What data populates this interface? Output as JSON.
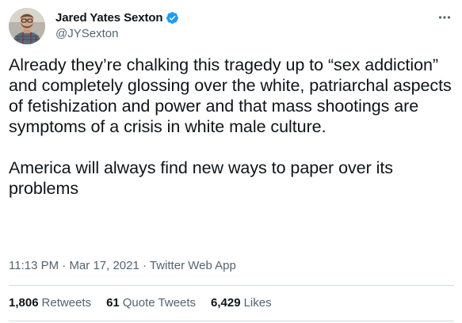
{
  "author": {
    "display_name": "Jared Yates Sexton",
    "handle": "@JYSexton",
    "verified": true,
    "avatar_icon": "user-avatar"
  },
  "tweet": {
    "text": "Already they’re chalking this tragedy up to “sex addiction” and completely glossing over the white, patriarchal aspects of fetishization and power and that mass shootings are symptoms of a crisis in white male culture.\n\nAmerica will always find new ways to paper over its problems",
    "time": "11:13 PM",
    "separator": " · ",
    "date": "Mar 17, 2021",
    "source": "Twitter Web App"
  },
  "stats": {
    "retweets_count": "1,806",
    "retweets_label": "Retweets",
    "quotes_count": "61",
    "quotes_label": "Quote Tweets",
    "likes_count": "6,429",
    "likes_label": "Likes"
  },
  "icons": {
    "verified": "verified-badge-icon",
    "more": "more-options-icon"
  },
  "colors": {
    "text_primary": "#0f1419",
    "text_secondary": "#536471",
    "verified_blue": "#1d9bf0",
    "divider": "#cfd9de"
  }
}
